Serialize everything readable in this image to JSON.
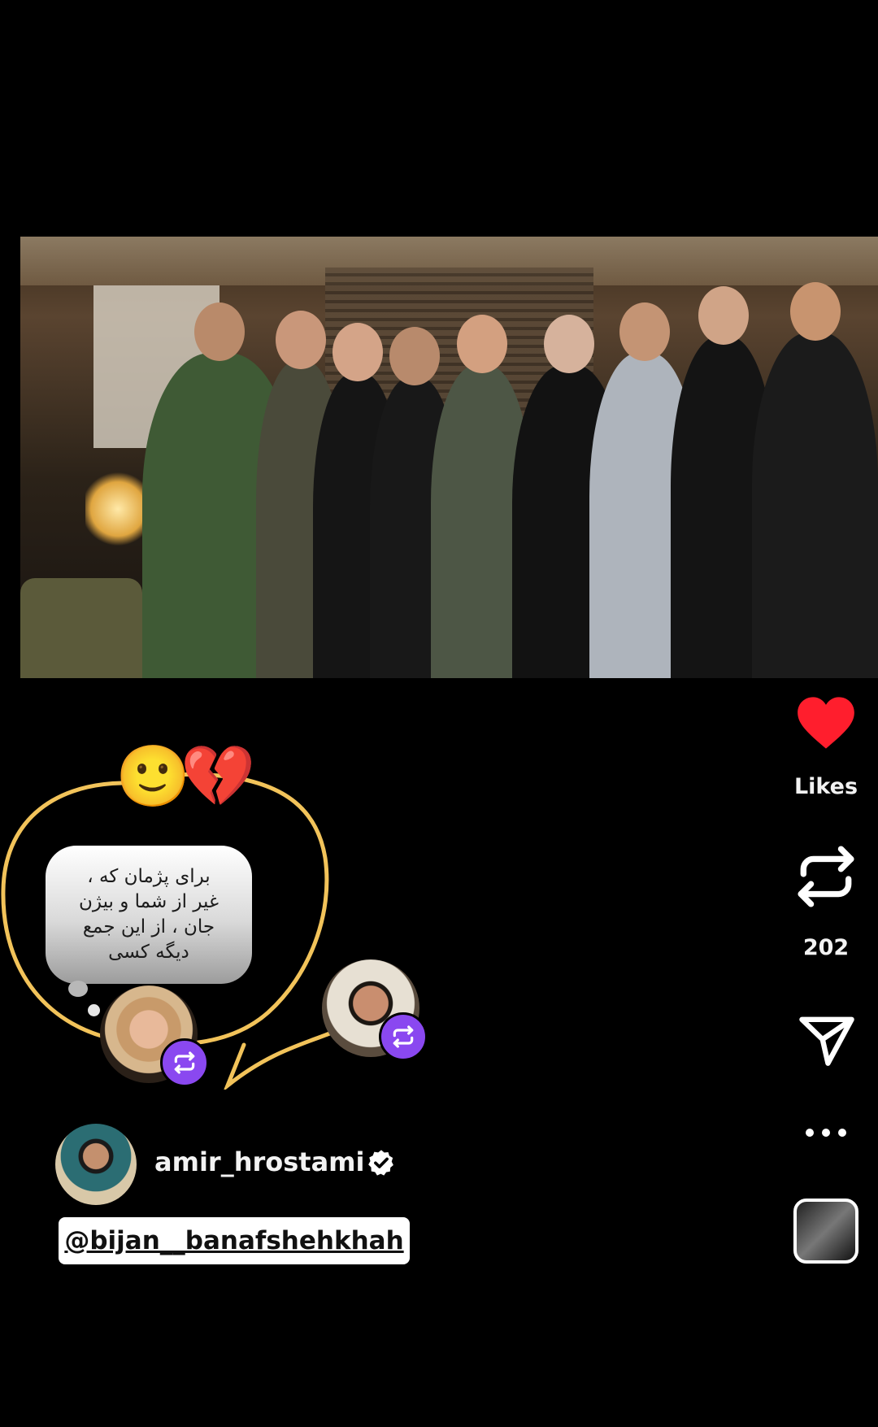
{
  "post": {
    "image_alt": "Group photo of nine men standing together in a living room"
  },
  "actions": {
    "likes_label": "Likes",
    "repost_count": "202",
    "heart_color": "#ff1e2d",
    "repost_icon": "repost-icon",
    "share_icon": "send-icon",
    "more_icon": "more-dots-icon"
  },
  "note": {
    "emojis": [
      "🙂",
      "💔"
    ],
    "text": "برای پژمان که ،\nغیر از شما و بیژن\nجان ، از این جمع\nدیگه کسی",
    "loop_color": "#f2c35a",
    "badge_color": "#8a48f0"
  },
  "author": {
    "username": "amir_hrostami",
    "verified": true,
    "mention": "@bijan__banafshehkhah"
  }
}
